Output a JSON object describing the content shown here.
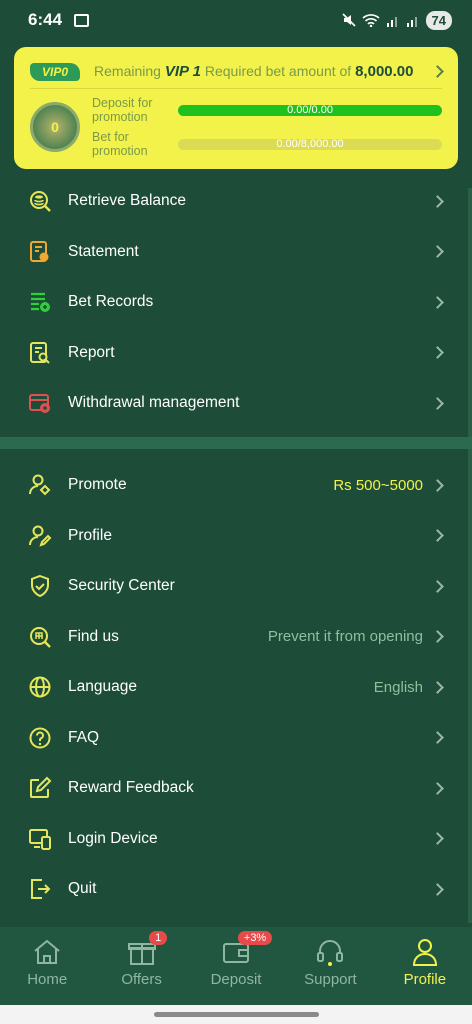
{
  "status": {
    "time": "6:44",
    "battery": "74"
  },
  "vip": {
    "badge": "VIP0",
    "prefix": "Remaining",
    "level": "VIP 1",
    "middle": "Required bet amount of",
    "amount": "8,000.00",
    "medal_level": "0",
    "rows": [
      {
        "label": "Deposit for promotion",
        "value": "0.00/0.00",
        "progress": 1.0
      },
      {
        "label": "Bet for promotion",
        "value": "0.00/8,000.00",
        "progress": 0.0
      }
    ]
  },
  "menu1": [
    {
      "label": "Retrieve Balance",
      "icon": "balance-icon"
    },
    {
      "label": "Statement",
      "icon": "statement-icon"
    },
    {
      "label": "Bet Records",
      "icon": "bet-records-icon"
    },
    {
      "label": "Report",
      "icon": "report-icon"
    },
    {
      "label": "Withdrawal management",
      "icon": "withdrawal-icon"
    }
  ],
  "menu2": [
    {
      "label": "Promote",
      "value": "Rs 500~5000",
      "icon": "promote-icon"
    },
    {
      "label": "Profile",
      "value": "",
      "icon": "profile-icon"
    },
    {
      "label": "Security Center",
      "value": "",
      "icon": "shield-icon"
    },
    {
      "label": "Find us",
      "value": "Prevent it from opening",
      "icon": "find-us-icon"
    },
    {
      "label": "Language",
      "value": "English",
      "icon": "globe-icon"
    },
    {
      "label": "FAQ",
      "value": "",
      "icon": "question-icon"
    },
    {
      "label": "Reward Feedback",
      "value": "",
      "icon": "edit-icon"
    },
    {
      "label": "Login Device",
      "value": "",
      "icon": "device-icon"
    },
    {
      "label": "Quit",
      "value": "",
      "icon": "quit-icon"
    }
  ],
  "tabs": [
    {
      "label": "Home",
      "badge": ""
    },
    {
      "label": "Offers",
      "badge": "1"
    },
    {
      "label": "Deposit",
      "badge": "+3%"
    },
    {
      "label": "Support",
      "badge": ""
    },
    {
      "label": "Profile",
      "badge": ""
    }
  ],
  "colors": {
    "accent": "#f2f24a",
    "background": "#1d4d39",
    "progress": "#1fc11f",
    "badge": "#e84a4a"
  }
}
